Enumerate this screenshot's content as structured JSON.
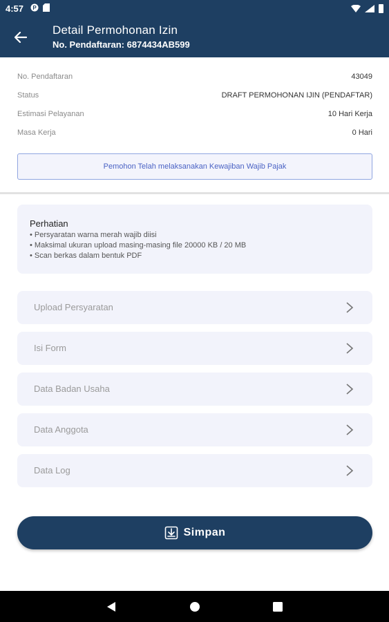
{
  "status_bar": {
    "time": "4:57"
  },
  "app_bar": {
    "title": "Detail Permohonan Izin",
    "subtitle": "No. Pendaftaran: 6874434AB599"
  },
  "info": [
    {
      "label": "No. Pendaftaran",
      "value": "43049"
    },
    {
      "label": "Status",
      "value": "DRAFT PERMOHONAN IJIN   (PENDAFTAR)"
    },
    {
      "label": "Estimasi Pelayanan",
      "value": "10 Hari Kerja"
    },
    {
      "label": "Masa Kerja",
      "value": "0 Hari"
    }
  ],
  "tax_button": "Pemohon Telah melaksanakan Kewajiban Wajib Pajak",
  "note": {
    "title": "Perhatian",
    "lines": [
      "• Persyaratan warna merah wajib diisi",
      "• Maksimal ukuran upload masing-masing file 20000 KB / 20 MB",
      "• Scan berkas dalam bentuk PDF"
    ]
  },
  "menu": [
    {
      "label": "Upload Persyaratan",
      "icon": "chevron-right-icon"
    },
    {
      "label": "Isi Form",
      "icon": "chevron-right-icon"
    },
    {
      "label": "Data Badan Usaha",
      "icon": "chevron-right-icon"
    },
    {
      "label": "Data Anggota",
      "icon": "chevron-right-icon"
    },
    {
      "label": "Data Log",
      "icon": "chevron-right-icon"
    }
  ],
  "save_button": {
    "label": "Simpan",
    "icon": "download-icon"
  },
  "colors": {
    "primary": "#1e3f62",
    "card_bg": "#f2f3fb",
    "link": "#4a62c4"
  }
}
